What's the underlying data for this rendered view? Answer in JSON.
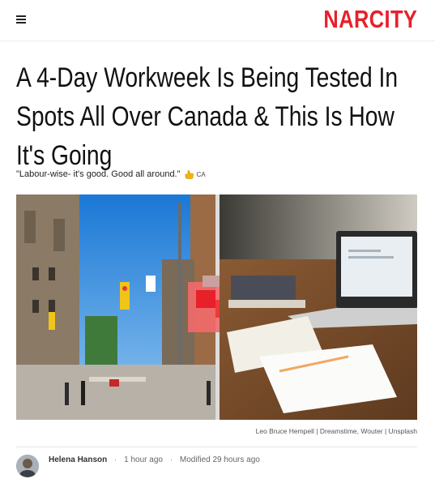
{
  "header": {
    "menu_icon": "hamburger-menu-icon",
    "logo_text": "NARCITY",
    "logo_color": "#e8202a"
  },
  "article": {
    "title": "A 4-Day Workweek Is Being Tested In Spots All Over Canada & This Is How It's Going",
    "subtitle": "\"Labour-wise- it's good. Good all around.\"",
    "subtitle_flag_icon": "pointing-hand-icon",
    "subtitle_region": "CA",
    "photo_credit": "Leo Bruce Hempell | Dreamstime, Wouter | Unsplash"
  },
  "byline": {
    "author": "Helena Hanson",
    "published": "1 hour ago",
    "modified": "Modified 29 hours ago",
    "separator": "·"
  }
}
